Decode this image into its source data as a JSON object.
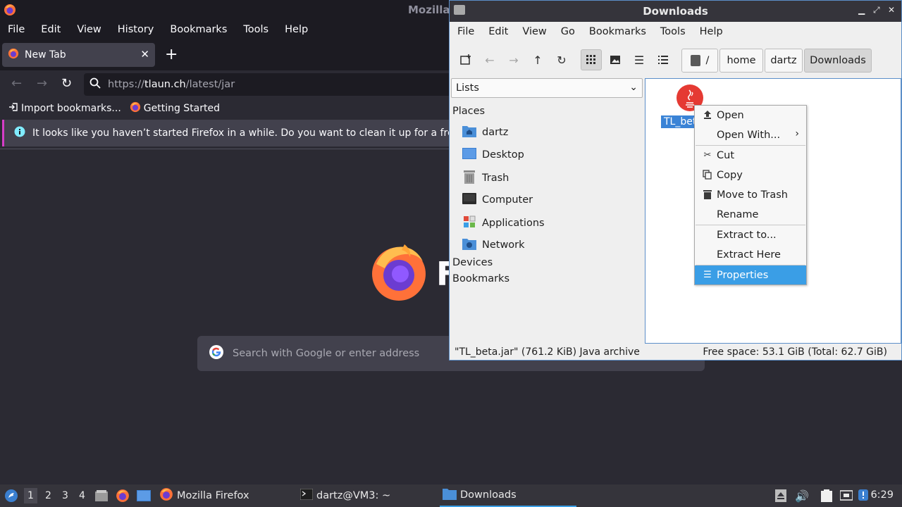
{
  "firefox": {
    "title": "Mozilla Firefox",
    "menu": [
      "File",
      "Edit",
      "View",
      "History",
      "Bookmarks",
      "Tools",
      "Help"
    ],
    "tab_label": "New Tab",
    "url_scheme": "https://",
    "url_host": "tlaun.ch",
    "url_path": "/latest/jar",
    "bookmarks": [
      "Import bookmarks...",
      "Getting Started"
    ],
    "notice": "It looks like you haven’t started Firefox in a while. Do you want to clean it up for a fresh,",
    "logo_letter": "F",
    "search_placeholder": "Search with Google or enter address"
  },
  "file_manager": {
    "title": "Downloads",
    "menu": [
      "File",
      "Edit",
      "View",
      "Go",
      "Bookmarks",
      "Tools",
      "Help"
    ],
    "breadcrumbs": [
      "/",
      "home",
      "dartz",
      "Downloads"
    ],
    "side_combo": "Lists",
    "sections": {
      "places": "Places",
      "devices": "Devices",
      "bookmarks": "Bookmarks"
    },
    "places": [
      "dartz",
      "Desktop",
      "Trash",
      "Computer",
      "Applications",
      "Network"
    ],
    "file_label": "TL_beta.jar",
    "status_left": "\"TL_beta.jar\" (761.2 KiB) Java archive",
    "status_right": "Free space: 53.1 GiB (Total: 62.7 GiB)"
  },
  "context_menu": {
    "items": [
      "Open",
      "Open With...",
      "Cut",
      "Copy",
      "Move to Trash",
      "Rename",
      "Extract to...",
      "Extract Here",
      "Properties"
    ],
    "selected": "Properties"
  },
  "taskbar": {
    "workspaces": [
      "1",
      "2",
      "3",
      "4"
    ],
    "tasks": [
      "Mozilla Firefox",
      "dartz@VM3: ~",
      "Downloads"
    ],
    "clock": "6:29"
  },
  "colors": {
    "accent": "#3a9ee6",
    "selection": "#3a83d6",
    "firefox_bg": "#2b2a33",
    "notice_border": "#d63dc8"
  }
}
